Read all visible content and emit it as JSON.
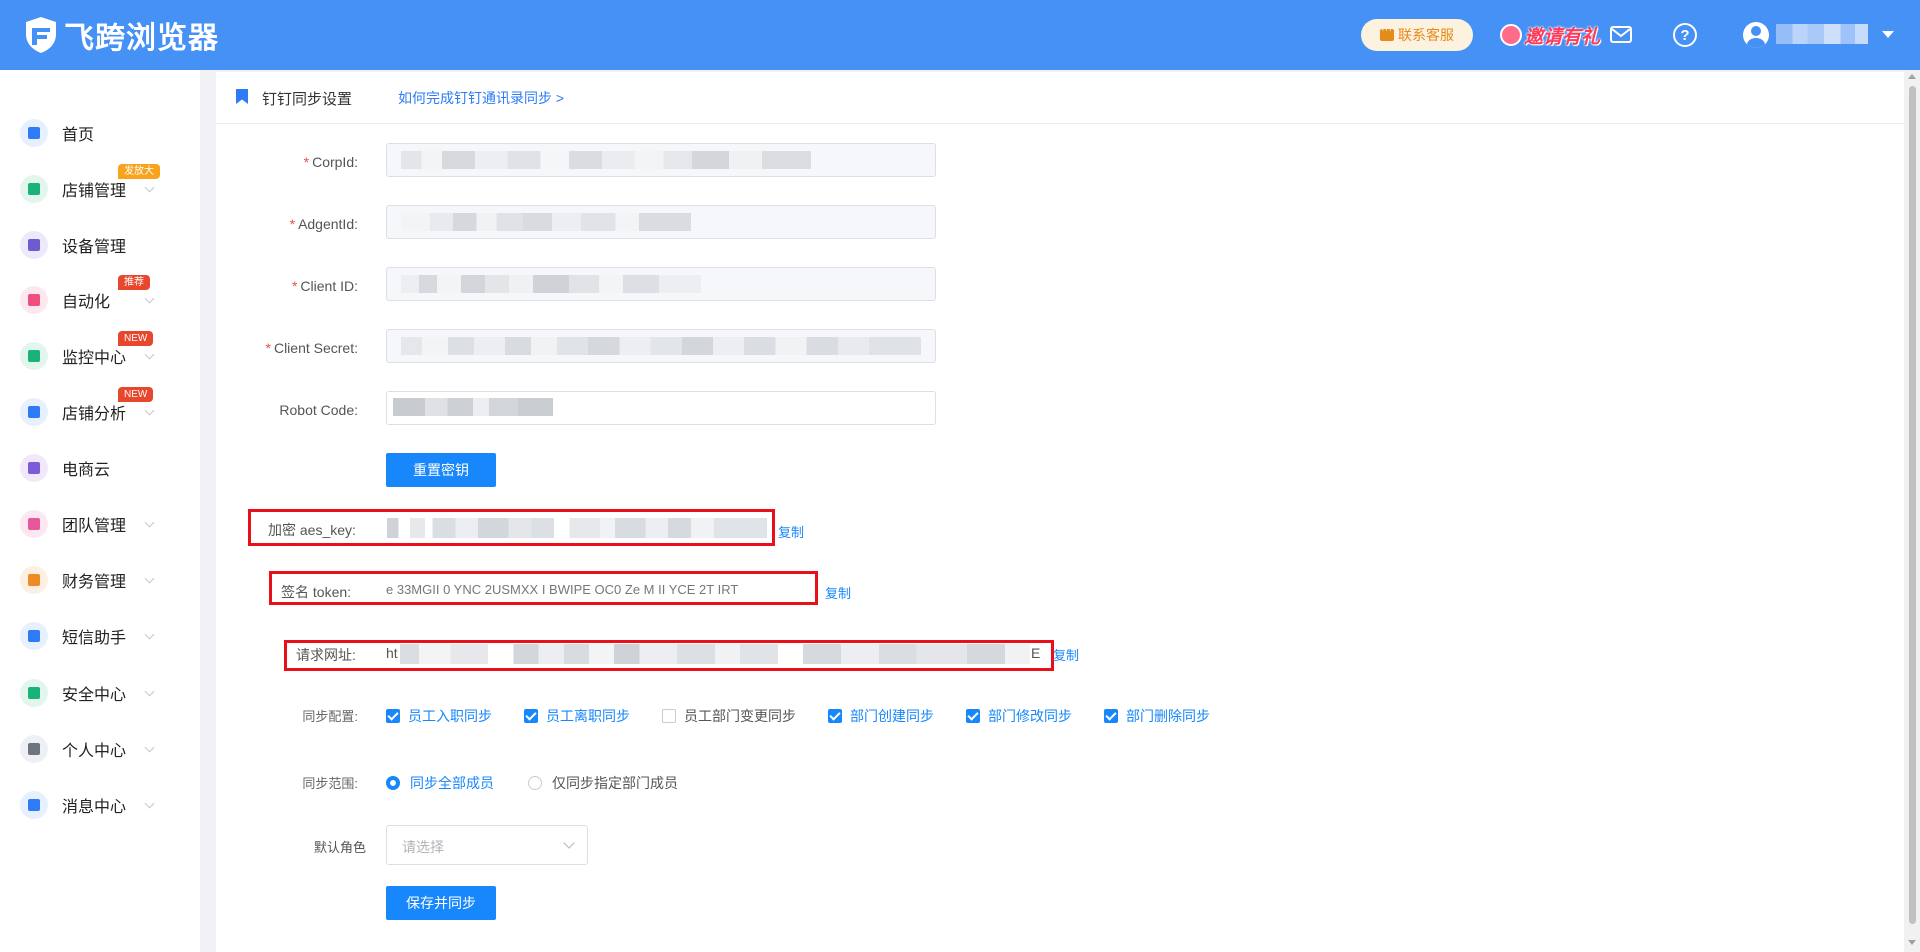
{
  "app": {
    "name": "飞跨浏览器",
    "support_label": "联系客服",
    "invite_label": "邀请有礼"
  },
  "sidebar": {
    "items": [
      {
        "label": "首页",
        "icon": "home-icon",
        "color": "#2d7cf6",
        "bg": "#e6f0fe",
        "has_chevron": false,
        "badge": null
      },
      {
        "label": "店铺管理",
        "icon": "store-icon",
        "color": "#19b37a",
        "bg": "#e2f6ee",
        "has_chevron": true,
        "badge": "发放大",
        "badge_color": "orange"
      },
      {
        "label": "设备管理",
        "icon": "device-icon",
        "color": "#6d5bd0",
        "bg": "#ece9fb",
        "has_chevron": false,
        "badge": null
      },
      {
        "label": "自动化",
        "icon": "robot-icon",
        "color": "#ee4f7e",
        "bg": "#fde8ef",
        "has_chevron": true,
        "badge": "推荐",
        "badge_color": "red"
      },
      {
        "label": "监控中心",
        "icon": "monitor-icon",
        "color": "#19b37a",
        "bg": "#e2f6ee",
        "has_chevron": true,
        "badge": "NEW",
        "badge_color": "red"
      },
      {
        "label": "店铺分析",
        "icon": "analytics-icon",
        "color": "#2d7cf6",
        "bg": "#e6f0fe",
        "has_chevron": true,
        "badge": "NEW",
        "badge_color": "red"
      },
      {
        "label": "电商云",
        "icon": "cloud-icon",
        "color": "#7d5bd8",
        "bg": "#efe9fb",
        "has_chevron": false,
        "badge": null
      },
      {
        "label": "团队管理",
        "icon": "team-icon",
        "color": "#e9579b",
        "bg": "#fde8f2",
        "has_chevron": true,
        "badge": null
      },
      {
        "label": "财务管理",
        "icon": "wallet-icon",
        "color": "#f08a24",
        "bg": "#fdf0e2",
        "has_chevron": true,
        "badge": null
      },
      {
        "label": "短信助手",
        "icon": "sms-icon",
        "color": "#2d7cf6",
        "bg": "#e6f0fe",
        "has_chevron": true,
        "badge": null
      },
      {
        "label": "安全中心",
        "icon": "shield-icon",
        "color": "#19b37a",
        "bg": "#e2f6ee",
        "has_chevron": true,
        "badge": null
      },
      {
        "label": "个人中心",
        "icon": "user-icon",
        "color": "#6c7480",
        "bg": "#eef0f3",
        "has_chevron": true,
        "badge": null
      },
      {
        "label": "消息中心",
        "icon": "bell-icon",
        "color": "#2d7cf6",
        "bg": "#e6f0fe",
        "has_chevron": true,
        "badge": null
      }
    ]
  },
  "page": {
    "title": "钉钉同步设置",
    "help_link": "如何完成钉钉通讯录同步 >"
  },
  "form": {
    "corp_id_label": "CorpId:",
    "agent_id_label": "AdgentId:",
    "client_id_label": "Client ID:",
    "client_secret_label": "Client Secret:",
    "robot_code_label": "Robot Code:",
    "reset_button": "重置密钥",
    "aes_key_label": "加密 aes_key:",
    "token_label": "签名 token:",
    "token_value_visible": "e  33MGII 0  YNC  2USMXX  I  BWIPE OC0  Ze M  II  YCE    2T IRT",
    "url_label": "请求网址:",
    "url_value_visible": "ht",
    "url_value_end": "E",
    "copy_label": "复制",
    "sync_config_label": "同步配置:",
    "sync_options": [
      {
        "label": "员工入职同步",
        "checked": true
      },
      {
        "label": "员工离职同步",
        "checked": true
      },
      {
        "label": "员工部门变更同步",
        "checked": false
      },
      {
        "label": "部门创建同步",
        "checked": true
      },
      {
        "label": "部门修改同步",
        "checked": true
      },
      {
        "label": "部门删除同步",
        "checked": true
      }
    ],
    "sync_scope_label": "同步范围:",
    "scope_options": [
      {
        "label": "同步全部成员",
        "selected": true
      },
      {
        "label": "仅同步指定部门成员",
        "selected": false
      }
    ],
    "default_role_label": "默认角色",
    "default_role_placeholder": "请选择",
    "save_button": "保存并同步"
  }
}
